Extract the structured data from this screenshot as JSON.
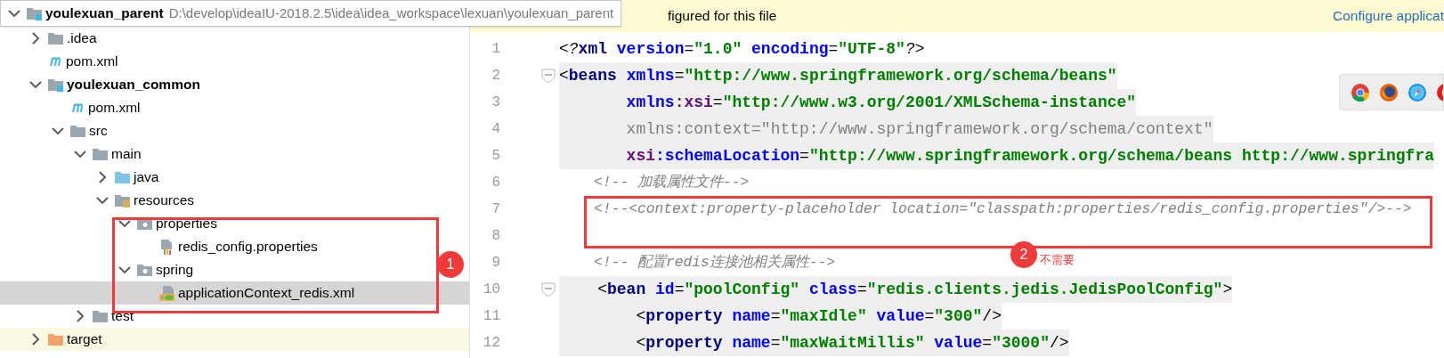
{
  "project_tree": [
    {
      "label": "youlexuan_parent",
      "path": "D:\\develop\\ideaIU-2018.2.5\\idea\\idea_workspace\\lexuan\\youlexuan_parent",
      "kind": "module",
      "expanded": true,
      "selected": false,
      "children": [
        {
          "label": ".idea",
          "kind": "folder",
          "expanded": false,
          "selected": false
        },
        {
          "label": "pom.xml",
          "kind": "maven",
          "selected": false
        },
        {
          "label": "youlexuan_common",
          "kind": "module",
          "expanded": true,
          "selected": false,
          "children": [
            {
              "label": "pom.xml",
              "kind": "maven",
              "selected": false
            },
            {
              "label": "src",
              "kind": "folder",
              "expanded": true,
              "selected": false,
              "children": [
                {
                  "label": "main",
                  "kind": "folder",
                  "expanded": true,
                  "selected": false,
                  "children": [
                    {
                      "label": "java",
                      "kind": "source-root",
                      "expanded": false,
                      "selected": false
                    },
                    {
                      "label": "resources",
                      "kind": "resources-root",
                      "expanded": true,
                      "selected": false,
                      "children": [
                        {
                          "label": "properties",
                          "kind": "package",
                          "expanded": true,
                          "selected": false,
                          "children": [
                            {
                              "label": "redis_config.properties",
                              "kind": "properties-file",
                              "selected": false
                            }
                          ]
                        },
                        {
                          "label": "spring",
                          "kind": "package",
                          "expanded": true,
                          "selected": false,
                          "children": [
                            {
                              "label": "applicationContext_redis.xml",
                              "kind": "spring-xml",
                              "selected": true
                            }
                          ]
                        }
                      ]
                    }
                  ]
                },
                {
                  "label": "test",
                  "kind": "folder",
                  "expanded": false,
                  "selected": false
                }
              ]
            }
          ]
        },
        {
          "label": "target",
          "kind": "excluded-folder",
          "expanded": false,
          "selected": false
        }
      ]
    }
  ],
  "banner": {
    "text": "figured for this file",
    "link": "Configure applicat"
  },
  "editor_lines": [
    {
      "number": "1",
      "fold": false,
      "shaded": false,
      "tokens": [
        {
          "kind": "pi",
          "text": "<?"
        },
        {
          "kind": "tag",
          "text": "xml"
        },
        {
          "kind": "attr",
          "text": " version"
        },
        {
          "kind": "plain",
          "text": "="
        },
        {
          "kind": "value",
          "text": "\"1.0\""
        },
        {
          "kind": "attr",
          "text": " encoding"
        },
        {
          "kind": "plain",
          "text": "="
        },
        {
          "kind": "value",
          "text": "\"UTF-8\""
        },
        {
          "kind": "pi",
          "text": "?>"
        }
      ]
    },
    {
      "number": "2",
      "fold": true,
      "shaded": true,
      "tokens": [
        {
          "kind": "plain",
          "text": "<"
        },
        {
          "kind": "tag",
          "text": "beans"
        },
        {
          "kind": "attr",
          "text": " xmlns"
        },
        {
          "kind": "plain",
          "text": "="
        },
        {
          "kind": "value",
          "text": "\"http://www.springframework.org/schema/beans\""
        }
      ]
    },
    {
      "number": "3",
      "fold": false,
      "shaded": true,
      "tokens": [
        {
          "kind": "attr",
          "text": "       xmlns"
        },
        {
          "kind": "ns",
          "text": ":xsi"
        },
        {
          "kind": "plain",
          "text": "="
        },
        {
          "kind": "value",
          "text": "\"http://www.w3.org/2001/XMLSchema-instance\""
        }
      ]
    },
    {
      "number": "4",
      "fold": false,
      "shaded": true,
      "tokens": [
        {
          "kind": "unused",
          "text": "       xmlns:context=\"http://www.springframework.org/schema/context\""
        }
      ]
    },
    {
      "number": "5",
      "fold": false,
      "shaded": true,
      "tokens": [
        {
          "kind": "ns",
          "text": "       xsi"
        },
        {
          "kind": "attr",
          "text": ":schemaLocation"
        },
        {
          "kind": "plain",
          "text": "="
        },
        {
          "kind": "value",
          "text": "\"http://www.springframework.org/schema/beans http://www.springfra"
        }
      ]
    },
    {
      "number": "6",
      "fold": false,
      "shaded": false,
      "tokens": [
        {
          "kind": "comment",
          "text": "    <!-- 加载属性文件-->"
        }
      ]
    },
    {
      "number": "7",
      "fold": false,
      "shaded": false,
      "tokens": [
        {
          "kind": "comment",
          "text": "    <!--<context:property-placeholder location=\"classpath:properties/redis_config.properties\"/>-->"
        }
      ]
    },
    {
      "number": "8",
      "fold": false
    },
    {
      "number": "9",
      "fold": false,
      "shaded": false,
      "tokens": [
        {
          "kind": "comment",
          "text": "    <!-- 配置redis连接池相关属性-->"
        }
      ]
    },
    {
      "number": "10",
      "fold": true,
      "shaded": true,
      "tokens": [
        {
          "kind": "plain",
          "text": "    <"
        },
        {
          "kind": "tag",
          "text": "bean"
        },
        {
          "kind": "attr",
          "text": " id"
        },
        {
          "kind": "plain",
          "text": "="
        },
        {
          "kind": "value",
          "text": "\"poolConfig\""
        },
        {
          "kind": "attr",
          "text": " class"
        },
        {
          "kind": "plain",
          "text": "="
        },
        {
          "kind": "value",
          "text": "\"redis.clients.jedis.JedisPoolConfig\""
        },
        {
          "kind": "plain",
          "text": ">"
        }
      ]
    },
    {
      "number": "11",
      "fold": false,
      "shaded": true,
      "tokens": [
        {
          "kind": "plain",
          "text": "        <"
        },
        {
          "kind": "tag",
          "text": "property"
        },
        {
          "kind": "attr",
          "text": " name"
        },
        {
          "kind": "plain",
          "text": "="
        },
        {
          "kind": "value",
          "text": "\"maxIdle\""
        },
        {
          "kind": "attr",
          "text": " value"
        },
        {
          "kind": "plain",
          "text": "="
        },
        {
          "kind": "value",
          "text": "\"300\""
        },
        {
          "kind": "plain",
          "text": "/>"
        }
      ]
    },
    {
      "number": "12",
      "fold": false,
      "shaded": true,
      "tokens": [
        {
          "kind": "plain",
          "text": "        <"
        },
        {
          "kind": "tag",
          "text": "property"
        },
        {
          "kind": "attr",
          "text": " name"
        },
        {
          "kind": "plain",
          "text": "="
        },
        {
          "kind": "value",
          "text": "\"maxWaitMillis\""
        },
        {
          "kind": "attr",
          "text": " value"
        },
        {
          "kind": "plain",
          "text": "="
        },
        {
          "kind": "value",
          "text": "\"3000\""
        },
        {
          "kind": "plain",
          "text": "/>"
        }
      ]
    }
  ],
  "browser_icons": [
    {
      "kind": "chrome"
    },
    {
      "kind": "firefox"
    },
    {
      "kind": "safari"
    },
    {
      "kind": "opera"
    }
  ],
  "annotations": [
    {
      "label": "1"
    },
    {
      "label": "2",
      "note": "不需要"
    }
  ]
}
